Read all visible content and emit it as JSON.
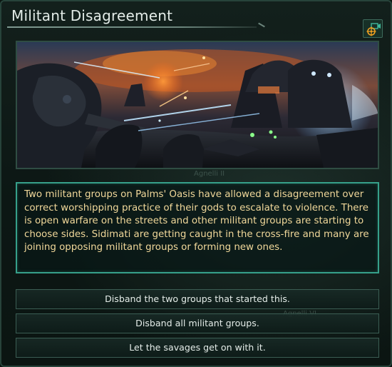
{
  "window": {
    "title": "Militant Disagreement"
  },
  "icons": {
    "camera": "camera-target-icon"
  },
  "colors": {
    "accent": "#36a08a",
    "description_text": "#f1d89a",
    "option_text": "#e4ece8"
  },
  "event": {
    "description": "Two militant groups on Palms' Oasis have allowed a disagreement over correct worshipping practice of their gods to escalate to violence. There is open warfare on the streets and other militant groups are starting to choose sides. Sidimati are getting caught in the cross-fire and many are joining opposing militant groups or forming new ones."
  },
  "options": [
    {
      "label": "Disband the two groups that started this."
    },
    {
      "label": "Disband all militant groups."
    },
    {
      "label": "Let the savages get on with it."
    }
  ],
  "background": {
    "label_a": "Agnelli II",
    "label_b": "Agnelli VI"
  }
}
